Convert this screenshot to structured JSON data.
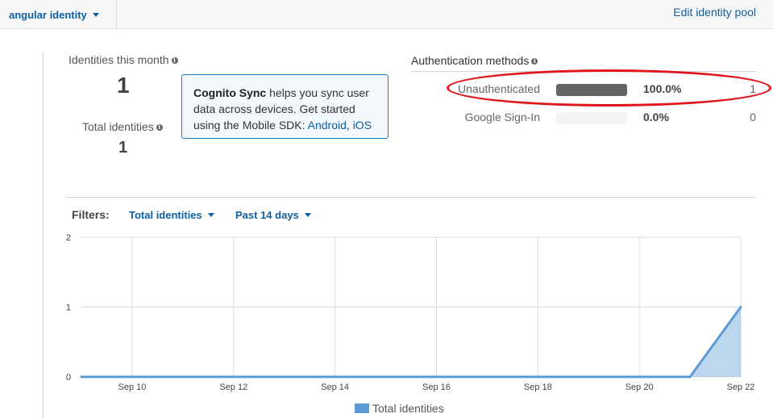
{
  "header": {
    "pool_name": "angular identity",
    "edit_link": "Edit identity pool"
  },
  "stats": {
    "identities_month_label": "Identities this month",
    "identities_month_value": "1",
    "total_identities_label": "Total identities",
    "total_identities_value": "1",
    "info_icon": "i"
  },
  "sync_box": {
    "title": "Cognito Sync",
    "text": " helps you sync user data across devices. Get started using the Mobile SDK: ",
    "android_link": "Android",
    "separator": ", ",
    "ios_link": "iOS"
  },
  "auth_methods": {
    "title": "Authentication methods",
    "rows": [
      {
        "name": "Unauthenticated",
        "percent_label": "100.0%",
        "fraction": 1.0,
        "count": "1"
      },
      {
        "name": "Google Sign-In",
        "percent_label": "0.0%",
        "fraction": 0.0,
        "count": "0"
      }
    ],
    "highlight_color": "#e0151b"
  },
  "filters": {
    "label": "Filters:",
    "metric": "Total identities",
    "range": "Past 14 days"
  },
  "chart_data": {
    "type": "area",
    "x": [
      "Sep 9",
      "Sep 10",
      "Sep 11",
      "Sep 12",
      "Sep 13",
      "Sep 14",
      "Sep 15",
      "Sep 16",
      "Sep 17",
      "Sep 18",
      "Sep 19",
      "Sep 20",
      "Sep 21",
      "Sep 22"
    ],
    "x_tick_labels": [
      "Sep 10",
      "Sep 12",
      "Sep 14",
      "Sep 16",
      "Sep 18",
      "Sep 20",
      "Sep 22"
    ],
    "series": [
      {
        "name": "Total identities",
        "values": [
          0,
          0,
          0,
          0,
          0,
          0,
          0,
          0,
          0,
          0,
          0,
          0,
          0,
          1
        ],
        "color": "#5b9bd5"
      }
    ],
    "ylim": [
      0,
      2
    ],
    "y_ticks": [
      0,
      1,
      2
    ],
    "grid": true,
    "legend": "bottom"
  },
  "colors": {
    "link": "#0f5fa3",
    "bar_fill": "#646464",
    "series": "#5b9bd5"
  }
}
